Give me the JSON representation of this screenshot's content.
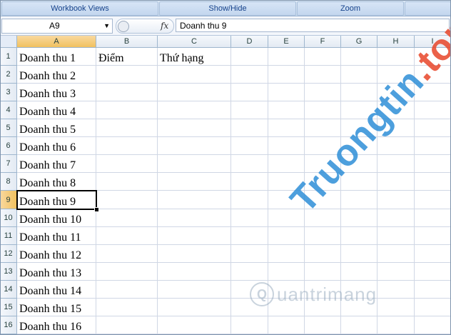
{
  "ribbon": {
    "groups": [
      "Workbook Views",
      "Show/Hide",
      "Zoom"
    ]
  },
  "formula_bar": {
    "name_box": "A9",
    "fx_label": "fx",
    "content": "Doanh thu 9"
  },
  "sheet": {
    "columns": [
      "A",
      "B",
      "C",
      "D",
      "E",
      "F",
      "G",
      "H",
      "I"
    ],
    "rows": [
      "1",
      "2",
      "3",
      "4",
      "5",
      "6",
      "7",
      "8",
      "9",
      "10",
      "11",
      "12",
      "13",
      "14",
      "15",
      "16"
    ],
    "selected_column": "A",
    "selected_row": "9",
    "header_row": {
      "A": "Doanh thu 1",
      "B": "Điểm",
      "C": "Thứ hạng"
    },
    "col_a": [
      "Doanh thu 1",
      "Doanh thu 2",
      "Doanh thu 3",
      "Doanh thu 4",
      "Doanh thu 5",
      "Doanh thu 6",
      "Doanh thu 7",
      "Doanh thu 8",
      "Doanh thu 9",
      "Doanh thu 10",
      "Doanh thu 11",
      "Doanh thu 12",
      "Doanh thu 13",
      "Doanh thu 14",
      "Doanh thu 15",
      "Doanh thu 16"
    ]
  },
  "watermarks": {
    "truongtin_main": "Truongtin",
    "truongtin_tld": ".top",
    "quantrimang": "uantrimang"
  }
}
